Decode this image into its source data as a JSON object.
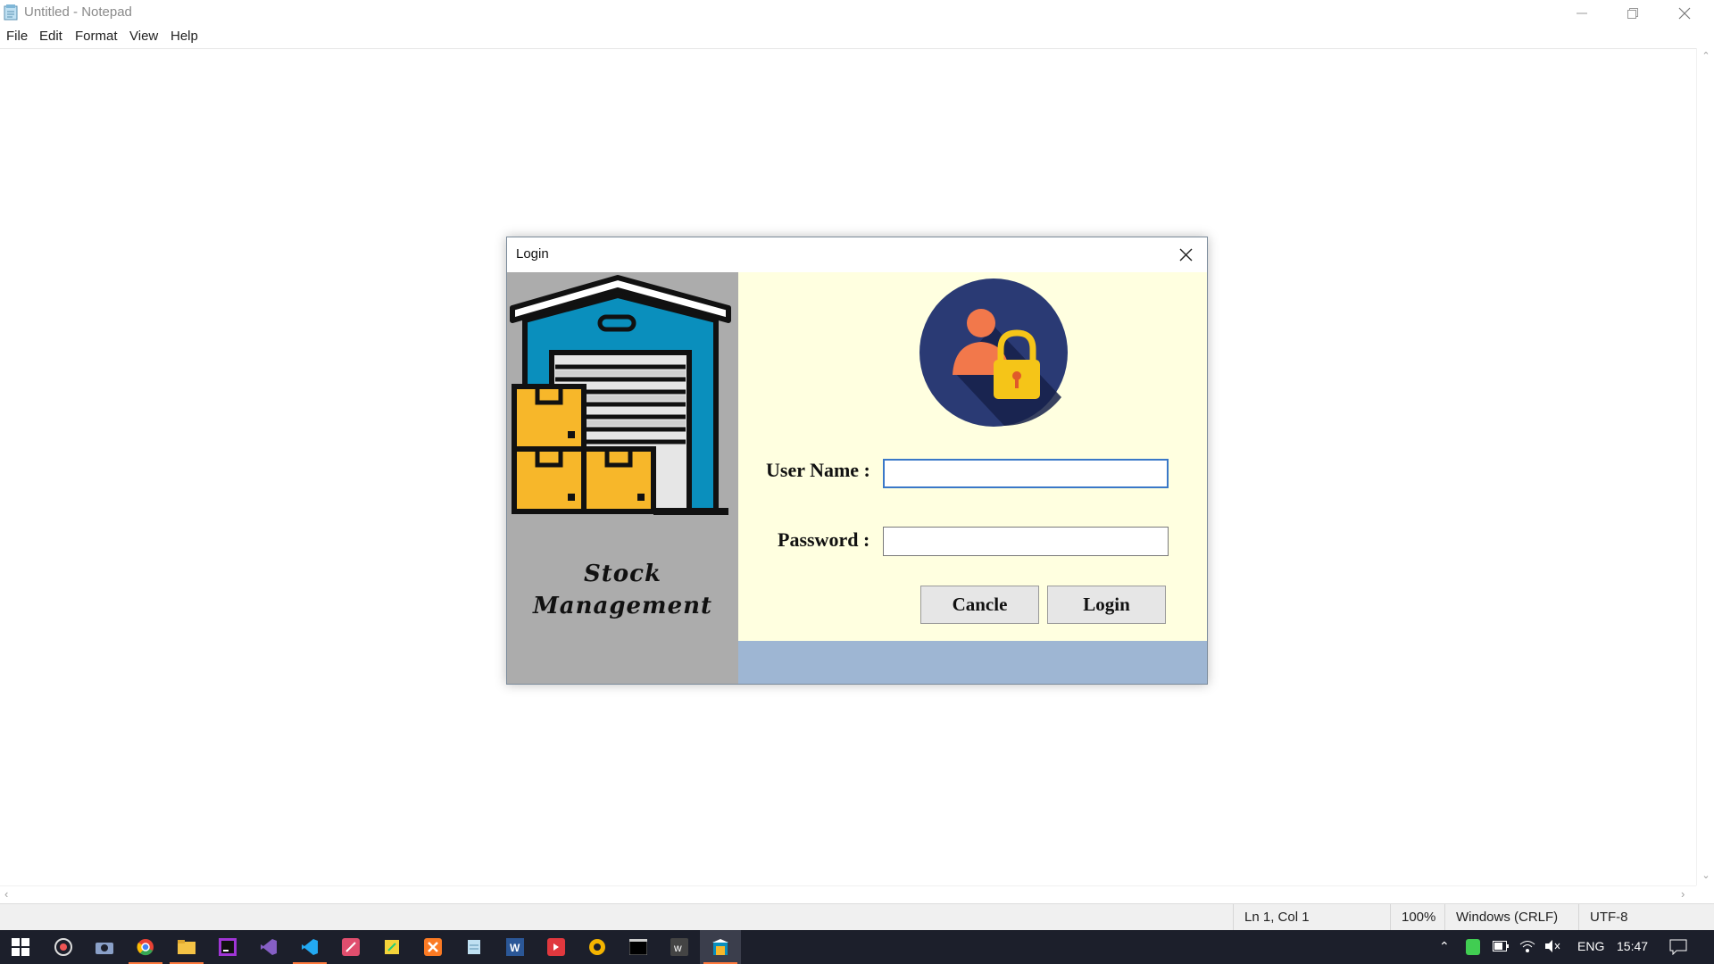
{
  "window": {
    "title": "Untitled - Notepad",
    "icon": "notepad-icon",
    "controls": [
      "minimize-icon",
      "restore-icon",
      "close-icon"
    ]
  },
  "menu": {
    "file": {
      "u": "F",
      "rest": "ile"
    },
    "edit": {
      "u": "E",
      "rest": "dit"
    },
    "format": {
      "u": "",
      "rest": "Format",
      "u2": "o"
    },
    "view": {
      "u": "V",
      "rest": "iew"
    },
    "help": {
      "u": "H",
      "rest": "elp"
    }
  },
  "menu_labels": [
    "File",
    "Edit",
    "Format",
    "View",
    "Help"
  ],
  "statusbar": {
    "position": "Ln 1, Col 1",
    "zoom": "100%",
    "line_ending": "Windows (CRLF)",
    "encoding": "UTF-8"
  },
  "dialog": {
    "title": "Login",
    "brand_line1": "Stock",
    "brand_line2": "Management",
    "username_label": "User Name :",
    "password_label": "Password :",
    "username_value": "",
    "password_value": "",
    "cancel_label": "Cancle",
    "login_label": "Login",
    "colors": {
      "left_panel": "#acacac",
      "right_panel": "#ffffe0",
      "bottom_strip": "#9eb6d3"
    }
  },
  "taskbar": {
    "apps": [
      "windows-start-icon",
      "media-icon",
      "camera-icon",
      "chrome-icon",
      "file-explorer-icon",
      "jetbrains-icon",
      "visual-studio-icon",
      "vscode-icon",
      "quill-icon",
      "sticky-icon",
      "xampp-icon",
      "notepad-icon",
      "word-icon",
      "app-red-icon",
      "chrome-alt-icon",
      "terminal-icon",
      "wamp-icon",
      "stock-app-icon"
    ],
    "language": "ENG",
    "time": "15:47"
  }
}
